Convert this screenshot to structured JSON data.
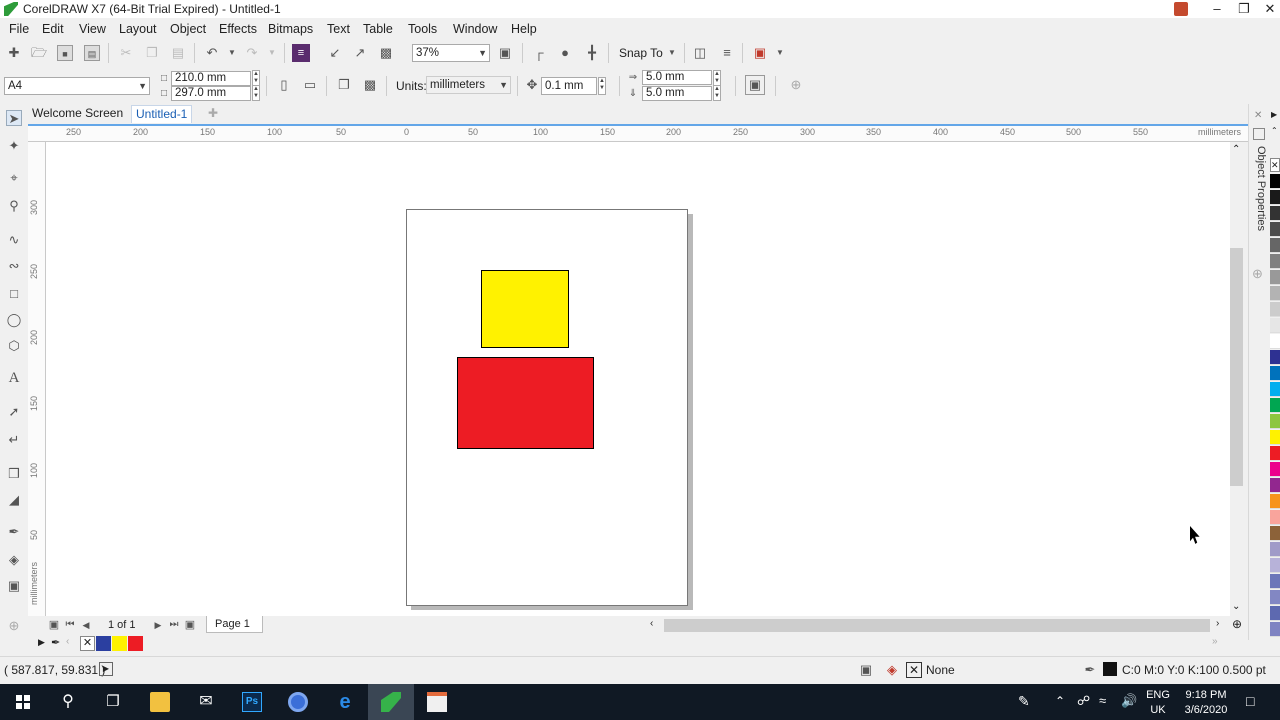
{
  "window": {
    "title": "CorelDRAW X7 (64-Bit Trial Expired) - Untitled-1"
  },
  "menu": [
    "File",
    "Edit",
    "View",
    "Layout",
    "Object",
    "Effects",
    "Bitmaps",
    "Text",
    "Table",
    "Tools",
    "Window",
    "Help"
  ],
  "toolbar": {
    "zoom": "37%",
    "snap_to": "Snap To"
  },
  "property_bar": {
    "page_size": "A4",
    "width": "210.0 mm",
    "height": "297.0 mm",
    "units_label": "Units:",
    "units_value": "millimeters",
    "nudge": "0.1 mm",
    "dup_x": "5.0 mm",
    "dup_y": "5.0 mm"
  },
  "tabs": [
    "Welcome Screen",
    "Untitled-1"
  ],
  "ruler": {
    "h_ticks": [
      "250",
      "200",
      "150",
      "100",
      "50",
      "0",
      "50",
      "100",
      "150",
      "200",
      "250",
      "300",
      "350",
      "400",
      "450",
      "500",
      "550"
    ],
    "h_unit": "millimeters",
    "v_ticks": [
      "300",
      "250",
      "200",
      "150",
      "100",
      "50"
    ],
    "v_unit": "millimeters"
  },
  "shapes": [
    {
      "name": "yellow-rectangle",
      "color": "#fff200"
    },
    {
      "name": "red-rectangle",
      "color": "#ed1c24"
    }
  ],
  "docker": {
    "title": "Object Properties"
  },
  "page_nav": {
    "count": "1 of 1",
    "page_tab": "Page 1"
  },
  "doc_palette": [
    "#2b3fa0",
    "#fff200",
    "#ed1c24"
  ],
  "palette": [
    "#000000",
    "#1a1a1a",
    "#333333",
    "#4d4d4d",
    "#666666",
    "#808080",
    "#999999",
    "#b3b3b3",
    "#cccccc",
    "#e6e6e6",
    "#ffffff",
    "#2e3192",
    "#0072bc",
    "#00aeef",
    "#00a651",
    "#8dc63f",
    "#fff200",
    "#ed1c24",
    "#ec008c",
    "#92278f",
    "#f7941d",
    "#f9a49c",
    "#8c6239",
    "#a09bc8",
    "#b7b2d9",
    "#6c76b9",
    "#8287c3",
    "#5d69b0",
    "#7f83c2"
  ],
  "status": {
    "coords": "( 587.817, 59.831 )",
    "fill_none": "None",
    "outline": "C:0 M:0 Y:0 K:100  0.500 pt"
  },
  "taskbar": {
    "lang1": "ENG",
    "lang2": "UK",
    "time": "9:18 PM",
    "date": "3/6/2020"
  }
}
